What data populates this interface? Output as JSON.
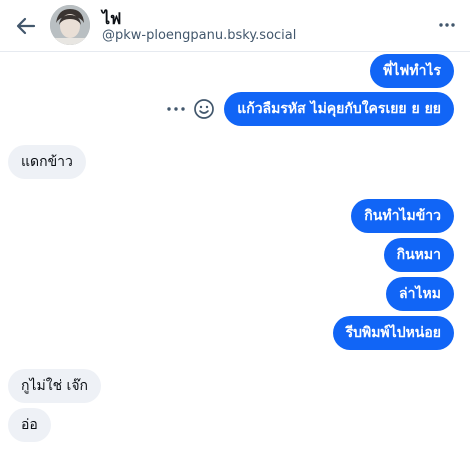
{
  "header": {
    "back_icon": "arrow-left-icon",
    "name": "ไฟ",
    "handle": "@pkw-ploengpanu.bsky.social",
    "more_icon": "more-horizontal-icon"
  },
  "colors": {
    "outgoing_bubble": "#1165f6",
    "incoming_bubble": "#eef1f6",
    "text_dark": "#0b0f14",
    "text_muted": "#42576c"
  },
  "messages": [
    {
      "from": "me",
      "text": "พี่ไฟทำไร"
    },
    {
      "from": "me",
      "text": "แก้วลืมรหัส ไม่คุยกับใครเยย ย ยย"
    },
    {
      "from": "them",
      "text": "แดกข้าว"
    },
    {
      "from": "me",
      "text": "กินทำไมข้าว"
    },
    {
      "from": "me",
      "text": "กินหมา"
    },
    {
      "from": "me",
      "text": "ล่าไหม"
    },
    {
      "from": "me",
      "text": "รีบพิมพ์ไปหน่อย"
    },
    {
      "from": "them",
      "text": "กูไม่ใช่ เจ๊ก"
    },
    {
      "from": "them",
      "text": "อ่อ"
    }
  ],
  "message_actions": {
    "more_icon": "ellipsis-icon",
    "react_icon": "emoji-smile-icon"
  }
}
